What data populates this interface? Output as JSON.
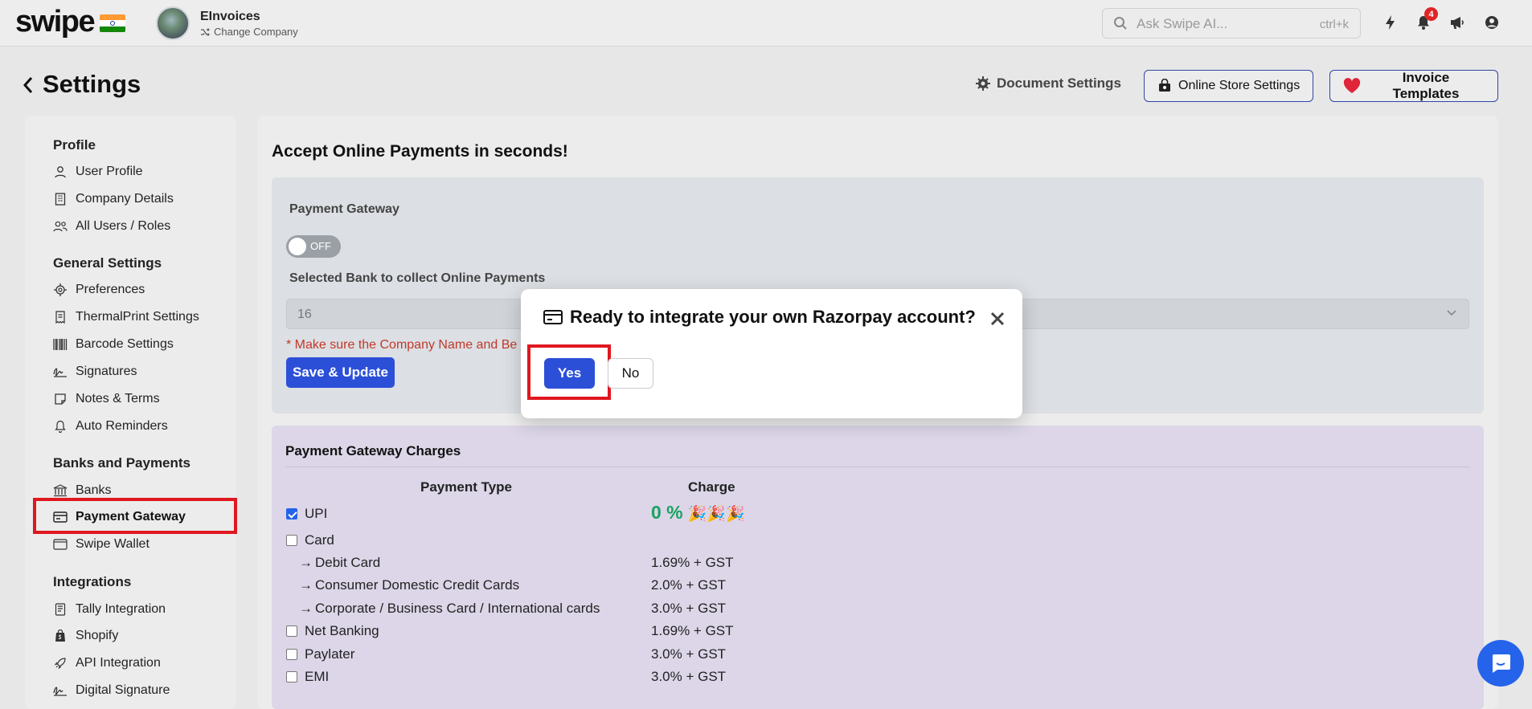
{
  "topbar": {
    "logo": "swipe",
    "flag_icon": "india-flag-icon",
    "company_name": "EInvoices",
    "change_company": "Change Company",
    "search_placeholder": "Ask Swipe AI...",
    "search_shortcut": "ctrl+k",
    "notification_count": "4",
    "icons": [
      "lightning-icon",
      "bell-icon",
      "megaphone-icon",
      "user-icon"
    ]
  },
  "header": {
    "title": "Settings",
    "document_settings": "Document Settings",
    "online_store_settings": "Online Store Settings",
    "invoice_templates": "Invoice Templates"
  },
  "sidebar": {
    "sections": [
      {
        "title": "Profile",
        "items": [
          {
            "label": "User Profile",
            "icon": "user-icon"
          },
          {
            "label": "Company Details",
            "icon": "building-icon"
          },
          {
            "label": "All Users / Roles",
            "icon": "users-icon"
          }
        ]
      },
      {
        "title": "General Settings",
        "items": [
          {
            "label": "Preferences",
            "icon": "gear-icon"
          },
          {
            "label": "ThermalPrint Settings",
            "icon": "receipt-icon"
          },
          {
            "label": "Barcode Settings",
            "icon": "barcode-icon"
          },
          {
            "label": "Signatures",
            "icon": "signature-icon"
          },
          {
            "label": "Notes & Terms",
            "icon": "note-icon"
          },
          {
            "label": "Auto Reminders",
            "icon": "bell-icon"
          }
        ]
      },
      {
        "title": "Banks and Payments",
        "items": [
          {
            "label": "Banks",
            "icon": "bank-icon"
          },
          {
            "label": "Payment Gateway",
            "icon": "credit-card-icon",
            "active": true
          },
          {
            "label": "Swipe Wallet",
            "icon": "wallet-icon"
          }
        ]
      },
      {
        "title": "Integrations",
        "items": [
          {
            "label": "Tally Integration",
            "icon": "tally-icon"
          },
          {
            "label": "Shopify",
            "icon": "shopify-icon"
          },
          {
            "label": "API Integration",
            "icon": "rocket-icon"
          },
          {
            "label": "Digital Signature",
            "icon": "signature-icon"
          }
        ]
      }
    ]
  },
  "main": {
    "title": "Accept Online Payments in seconds!",
    "gateway_label": "Payment Gateway",
    "toggle_state": "OFF",
    "bank_label": "Selected Bank to collect Online Payments",
    "bank_value": "16",
    "warning": "* Make sure the Company Name and Be",
    "save_button": "Save & Update"
  },
  "charges": {
    "title": "Payment Gateway Charges",
    "col_type": "Payment Type",
    "col_charge": "Charge",
    "rows": [
      {
        "label": "UPI",
        "charge": "0 %",
        "checkbox": true,
        "checked": true,
        "sub": false
      },
      {
        "label": "Card",
        "charge": "",
        "checkbox": true,
        "checked": false,
        "sub": false
      },
      {
        "label": "Debit Card",
        "charge": "1.69% + GST",
        "checkbox": false,
        "sub": true
      },
      {
        "label": "Consumer Domestic Credit Cards",
        "charge": "2.0% + GST",
        "checkbox": false,
        "sub": true
      },
      {
        "label": "Corporate / Business Card / International cards",
        "charge": "3.0% + GST",
        "checkbox": false,
        "sub": true
      },
      {
        "label": "Net Banking",
        "charge": "1.69% + GST",
        "checkbox": true,
        "checked": false,
        "sub": false
      },
      {
        "label": "Paylater",
        "charge": "3.0% + GST",
        "checkbox": true,
        "checked": false,
        "sub": false
      },
      {
        "label": "EMI",
        "charge": "3.0% + GST",
        "checkbox": true,
        "checked": false,
        "sub": false
      }
    ]
  },
  "modal": {
    "title": "Ready to integrate your own Razorpay account?",
    "yes": "Yes",
    "no": "No"
  },
  "colors": {
    "primary": "#2c4fd8",
    "highlight": "#e0171f",
    "success": "#1aa260",
    "warning": "#c0392b"
  }
}
